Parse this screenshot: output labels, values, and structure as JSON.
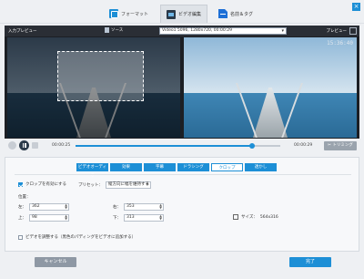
{
  "nav": {
    "tabs": [
      {
        "label": "フォーマット",
        "icon": "format-icon"
      },
      {
        "label": "ビデオ編集",
        "icon": "video-edit-icon"
      },
      {
        "label": "名前＆タグ",
        "icon": "rename-icon"
      }
    ],
    "active_tab": 1,
    "close_symbol": "×"
  },
  "preview": {
    "input_label": "入力プレビュー",
    "source_label": "ソース",
    "file_value": "Video1 5096, 1280x720, 00:00:29",
    "output_label": "プレビュー",
    "timestamp": "15:36:40"
  },
  "playback": {
    "current_time": "00:00:25",
    "end_time": "00:00:29",
    "progress": 0.86,
    "trim_label": "トリミング"
  },
  "edit": {
    "tabs": [
      "ビデオオーディオ",
      "効果",
      "字幕",
      "ドラシング",
      "クロップ",
      "透かし"
    ],
    "active_tab": 4,
    "enable_crop_label": "クロップを有効にする",
    "enable_crop_checked": true,
    "preset_label": "プリセット：",
    "preset_value": "縦方向に幅を維持する",
    "position_label": "位置：",
    "left_label": "左：",
    "left_value": "362",
    "right_label": "右：",
    "right_value": "353",
    "top_label": "上：",
    "top_value": "98",
    "bottom_label": "下：",
    "bottom_value": "313",
    "size_label": "サイズ：",
    "size_value": "564x316",
    "pad_label": "ビデオを調整する（黒色のパディングをビデオに追加する）",
    "pad_checked": false
  },
  "footer": {
    "cancel_label": "キャンセル",
    "done_label": "完了"
  },
  "colors": {
    "accent": "#1d8fd6",
    "cancel": "#8e98a4"
  }
}
